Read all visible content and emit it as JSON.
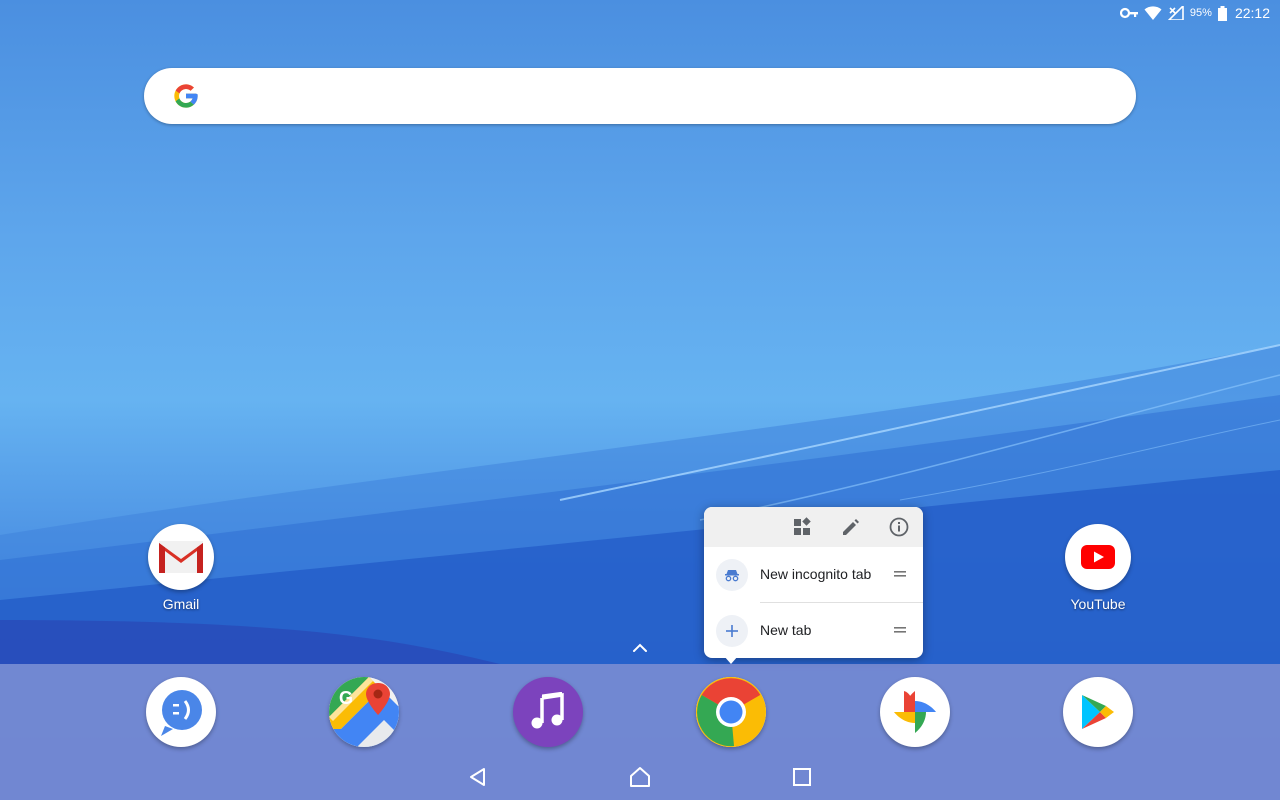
{
  "status_bar": {
    "battery_percent": "95%",
    "time": "22:12",
    "icons": [
      "vpn-key-icon",
      "wifi-icon",
      "cellular-signal-off-icon",
      "battery-icon"
    ]
  },
  "search": {
    "logo": "google-g-logo",
    "placeholder": ""
  },
  "desktop": {
    "shortcuts": [
      {
        "label": "Gmail",
        "icon": "gmail-icon"
      },
      {
        "label": "YouTube",
        "icon": "youtube-icon"
      }
    ]
  },
  "chrome_popup": {
    "header_icons": [
      "widgets-icon",
      "edit-icon",
      "app-info-icon"
    ],
    "items": [
      {
        "label": "New incognito tab",
        "icon": "incognito-icon"
      },
      {
        "label": "New tab",
        "icon": "plus-icon"
      }
    ]
  },
  "dock": {
    "apps": [
      "messaging-icon",
      "google-maps-icon",
      "music-icon",
      "chrome-icon",
      "google-photos-icon",
      "play-store-icon"
    ]
  },
  "nav_bar": {
    "buttons": [
      "back-icon",
      "home-icon",
      "recents-icon"
    ]
  },
  "colors": {
    "wallpaper_top": "#4b8fe0",
    "wallpaper_mid": "#66b3f1",
    "wallpaper_bottom": "#2d68cf",
    "dock": "#a0a0d7",
    "google_blue": "#4285f4",
    "google_red": "#ea4335",
    "google_yellow": "#fbbc05",
    "google_green": "#34a853"
  }
}
